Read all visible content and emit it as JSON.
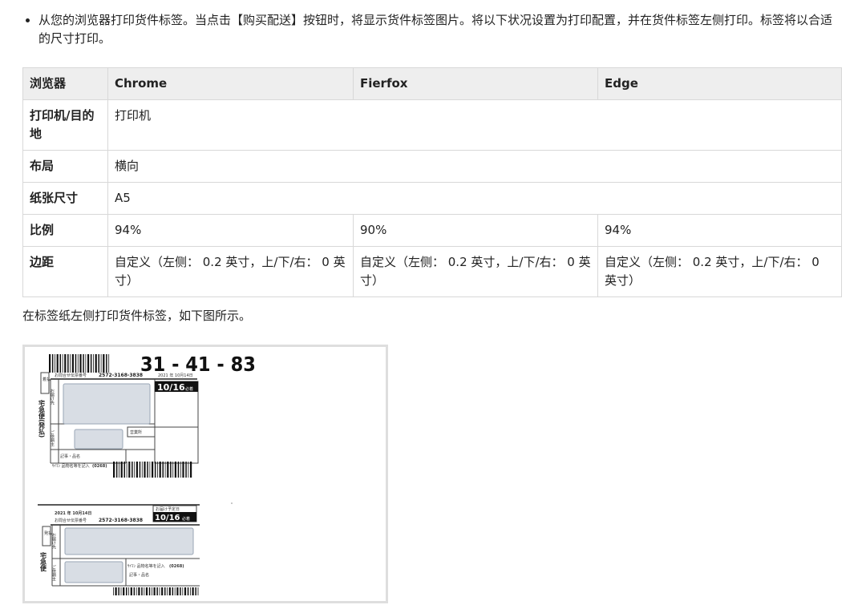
{
  "intro": {
    "text": "从您的浏览器打印货件标签。当点击【购买配送】按钮时，将显示货件标签图片。将以下状况设置为打印配置，并在货件标签左侧打印。标签将以合适的尺寸打印。"
  },
  "table": {
    "header": [
      "浏览器",
      "Chrome",
      "Fierfox",
      "Edge"
    ],
    "rows": {
      "printer": {
        "label": "打印机/目的地",
        "value": "打印机"
      },
      "layout": {
        "label": "布局",
        "value": "横向"
      },
      "paper": {
        "label": "纸张尺寸",
        "value": "A5"
      },
      "scale": {
        "label": "比例",
        "chrome": "94%",
        "firefox": "90%",
        "edge": "94%"
      },
      "margin": {
        "label": "边距",
        "chrome": "自定义（左侧： 0.2 英寸，上/下/右： 0 英寸）",
        "firefox": "自定义（左侧： 0.2 英寸，上/下/右： 0 英寸）",
        "edge": "自定义（左侧： 0.2 英寸，上/下/右： 0 英寸）"
      }
    }
  },
  "caption": "在标签纸左侧打印货件标签，如下图所示。",
  "label_image": {
    "upper": {
      "big_number": "31 - 41 - 83",
      "tracking_label": "お問合せ伝票番号",
      "tracking_number": "2572-3168-3838",
      "date_line": "2021 年 10月14日",
      "delivery_date": "10/16",
      "delivery_note": "必着",
      "carrier_vertical": "宅急便(発払)",
      "service_box": "着払",
      "side_labels": [
        "お届け先",
        "ご依頼主"
      ],
      "small_box": "営業所",
      "bottom_text": "ｻｲﾏﾝ 品物名等を記入",
      "bottom_code": "(0268)",
      "record_label": "記事・品名"
    },
    "lower": {
      "date_line": "2021 年 10月14日",
      "tracking_label": "お問合せ伝票番号",
      "tracking_number": "2572-3168-3838",
      "delivery_box_label": "お届け予定日",
      "delivery_date": "10/16",
      "delivery_note": "必着",
      "carrier_vertical": "宅急便",
      "service_box": "発払",
      "side_labels": [
        "お届け先",
        "ご依頼主"
      ],
      "bottom_text": "ｻｲﾏﾝ 品物名等を記入",
      "bottom_code": "(0268)",
      "record_label": "記事・品名"
    }
  }
}
